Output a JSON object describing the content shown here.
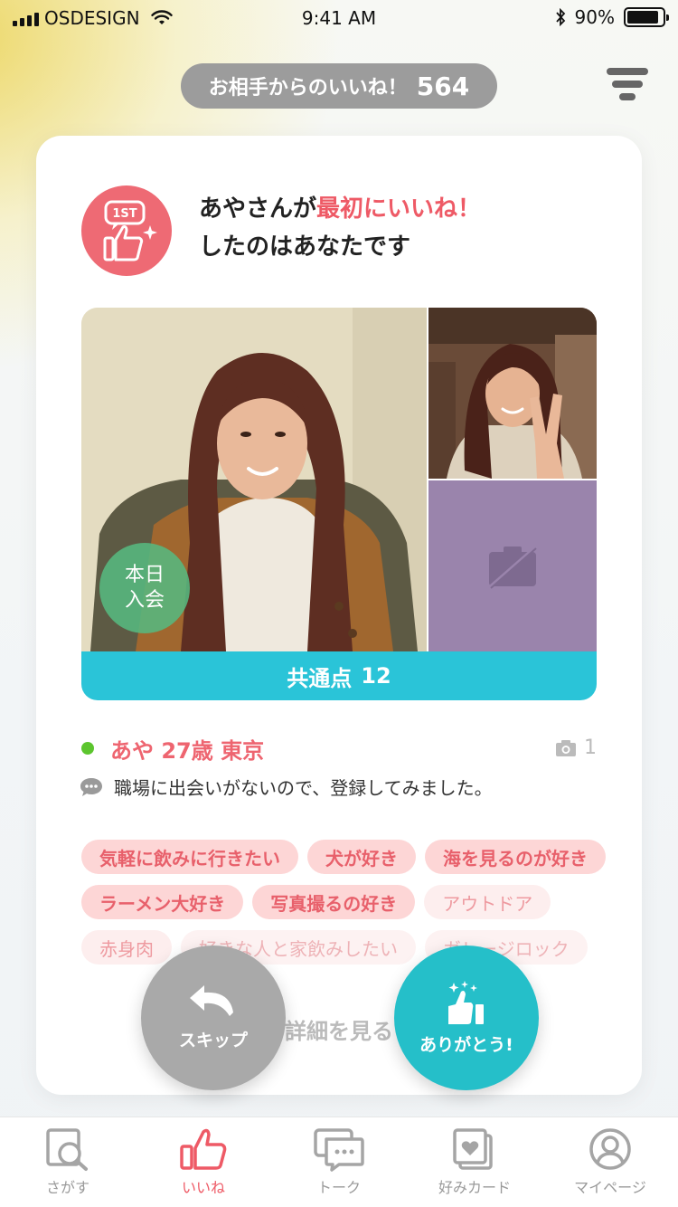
{
  "status_bar": {
    "carrier": "OSDESIGN",
    "time": "9:41 AM",
    "battery": "90%"
  },
  "header": {
    "likes_label": "お相手からのいいね！",
    "likes_count": "564"
  },
  "card": {
    "first_like_line1_prefix": "あやさんが",
    "first_like_line1_highlight": "最初にいいね！",
    "first_like_line2": "したのはあなたです",
    "first_badge_text": "1ST",
    "new_member_badge": [
      "本日",
      "入会"
    ],
    "common_points_label": "共通点",
    "common_points_count": "12",
    "profile": {
      "name_age_city": "あや 27歳 東京",
      "photo_count": "1"
    },
    "message": "職場に出会いがないので、登録してみました。",
    "tags": [
      [
        "気軽に飲みに行きたい",
        "犬が好き",
        "海を見るのが好き"
      ],
      [
        "ラーメン大好き",
        "写真撮るの好き",
        "アウトドア"
      ],
      [
        "赤身肉",
        "好きな人と家飲みしたい",
        "ガレージロック"
      ]
    ],
    "detail_link": "詳細を見る"
  },
  "actions": {
    "skip": "スキップ",
    "thanks": "ありがとう!"
  },
  "bottom_nav": {
    "items": [
      {
        "label": "さがす",
        "icon": "search-icon"
      },
      {
        "label": "いいね",
        "icon": "thumbs-up-icon"
      },
      {
        "label": "トーク",
        "icon": "chat-icon"
      },
      {
        "label": "好みカード",
        "icon": "heart-card-icon"
      },
      {
        "label": "マイページ",
        "icon": "user-icon"
      }
    ],
    "active_index": 1
  },
  "colors": {
    "accent_pink": "#ee5a66",
    "accent_teal": "#25bfc9",
    "common_bar": "#2ac4d8",
    "online": "#5cc52e"
  }
}
